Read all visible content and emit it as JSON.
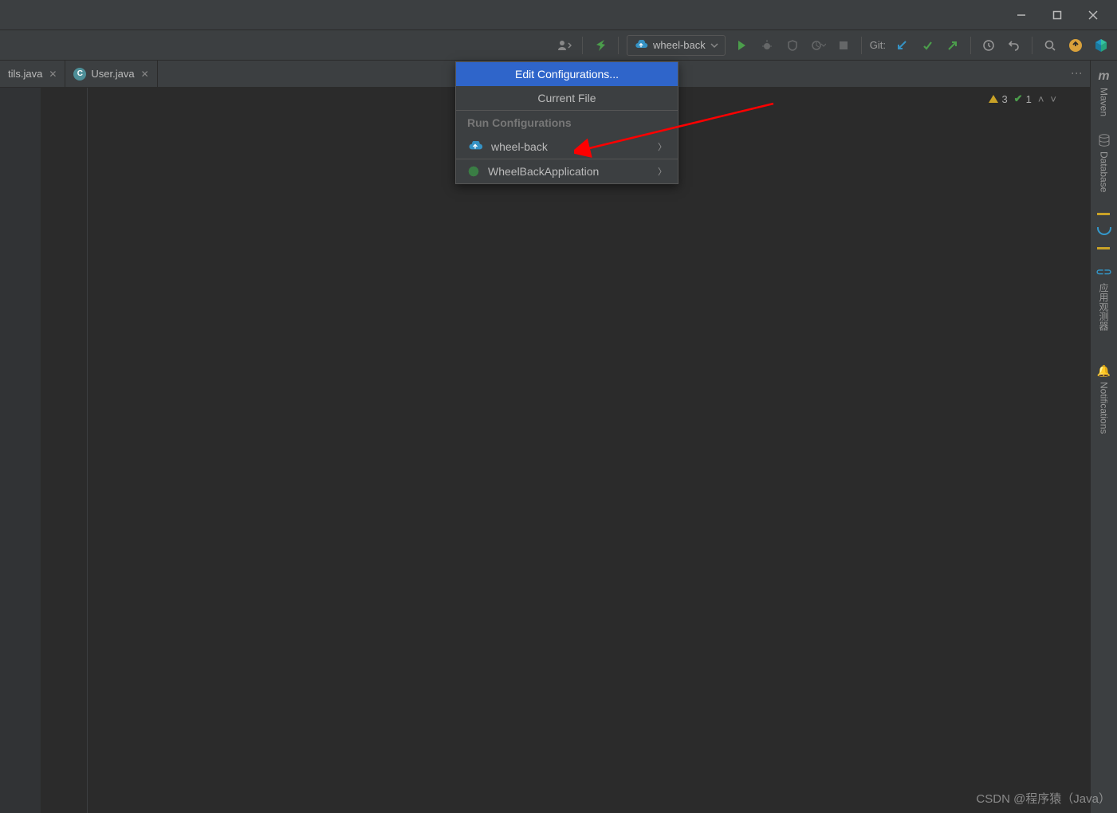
{
  "run_config_selected": "wheel-back",
  "git_label": "Git:",
  "tabs": [
    {
      "name": "tils.java"
    },
    {
      "name": "User.java"
    }
  ],
  "inspections": {
    "warnings": "3",
    "passes": "1"
  },
  "dropdown": {
    "edit": "Edit Configurations...",
    "current_file": "Current File",
    "section": "Run Configurations",
    "item1": "wheel-back",
    "item2": "WheelBackApplication"
  },
  "right_sidebar": {
    "maven": "Maven",
    "database": "Database",
    "app_observer": "应用观测器",
    "notifications": "Notifications"
  },
  "watermark": "CSDN @程序猿（Java）"
}
